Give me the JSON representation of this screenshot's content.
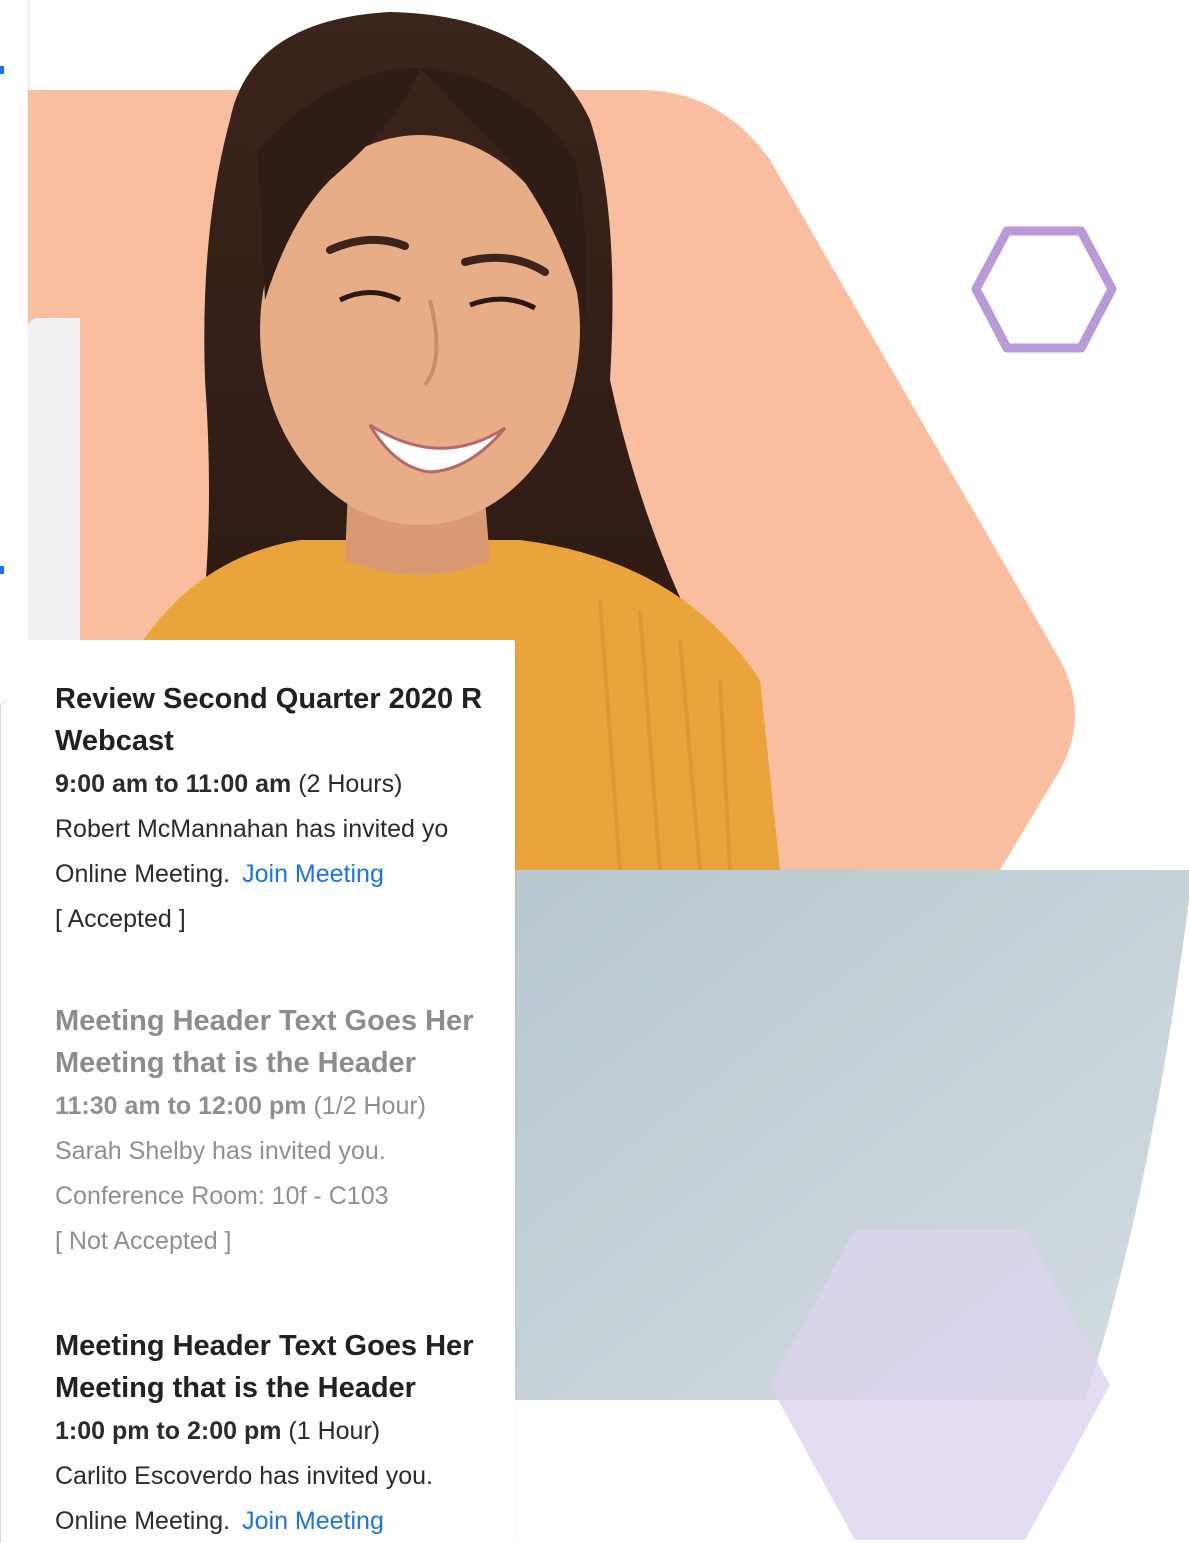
{
  "colors": {
    "hexagon_peach": "#f9bea0",
    "hexagon_outline": "#b89ad9",
    "hexagon_lavender": "#ddd3ef",
    "sweater": "#e9a43b",
    "laptop": "#c4d1d8",
    "link": "#1a73e8"
  },
  "meetings": [
    {
      "title_line1": "Review Second Quarter 2020 R",
      "title_line2": "Webcast",
      "time": "9:00 am to 11:00 am",
      "duration": "(2 Hours)",
      "invite": "Robert McMannahan has invited yo",
      "location": "Online Meeting.",
      "join_label": "Join Meeting",
      "status": "[ Accepted ]"
    },
    {
      "title_line1": "Meeting Header Text Goes Her",
      "title_line2": "Meeting that is the Header",
      "time": "11:30 am to 12:00 pm",
      "duration": "(1/2 Hour)",
      "invite": "Sarah Shelby has invited you.",
      "location": "Conference Room: 10f - C103",
      "status": "[ Not Accepted ]"
    },
    {
      "title_line1": "Meeting Header Text Goes Her",
      "title_line2": "Meeting that is the Header",
      "time": "1:00 pm to 2:00 pm",
      "duration": "(1 Hour)",
      "invite": "Carlito Escoverdo has invited you.",
      "location": "Online Meeting.",
      "join_label": "Join Meeting"
    }
  ]
}
